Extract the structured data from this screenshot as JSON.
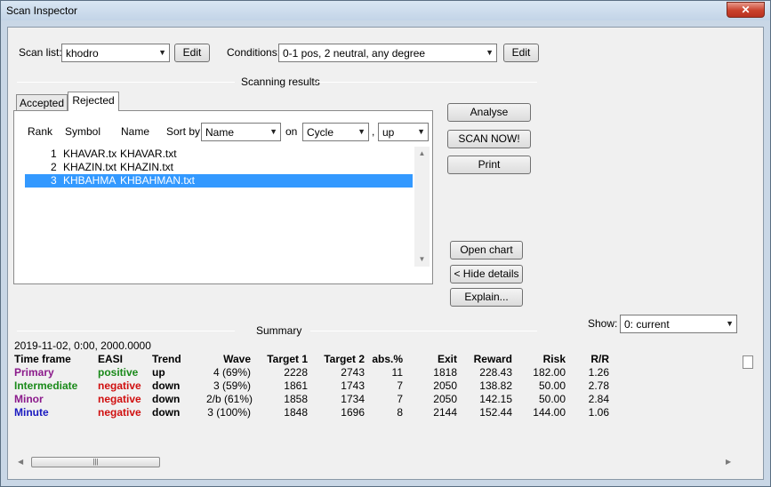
{
  "window": {
    "title": "Scan Inspector",
    "close_glyph": "✕"
  },
  "top": {
    "scan_list_label": "Scan list:",
    "scan_list_value": "khodro",
    "edit1_label": "Edit",
    "conditions_label": "Conditions:",
    "conditions_value": "0-1 pos, 2 neutral, any degree",
    "edit2_label": "Edit"
  },
  "results": {
    "section_label": "Scanning results",
    "tabs": [
      {
        "label": "Accepted"
      },
      {
        "label": "Rejected"
      }
    ],
    "headers": {
      "rank": "Rank",
      "symbol": "Symbol",
      "name": "Name",
      "sort_by": "Sort by",
      "on": "on",
      "comma": ","
    },
    "sort_by_value": "Name",
    "on_value": "Cycle",
    "direction_value": "up",
    "rows": [
      {
        "rank": "1",
        "symbol": "KHAVAR.tx",
        "name": "KHAVAR.txt"
      },
      {
        "rank": "2",
        "symbol": "KHAZIN.txt",
        "name": "KHAZIN.txt"
      },
      {
        "rank": "3",
        "symbol": "KHBAHMA",
        "name": "KHBAHMAN.txt"
      }
    ],
    "selected_index": 2
  },
  "side_buttons": {
    "analyse": "Analyse",
    "scan_now": "SCAN NOW!",
    "print": "Print",
    "open_chart": "Open chart",
    "hide_details": "< Hide details",
    "explain": "Explain..."
  },
  "summary": {
    "section_label": "Summary",
    "show_label": "Show:",
    "show_value": "0: current",
    "info_line": "2019-11-02, 0:00, 2000.0000",
    "headers": [
      "Time frame",
      "EASI",
      "Trend",
      "Wave",
      "Target 1",
      "Target 2",
      "abs.%",
      "Exit",
      "Reward",
      "Risk",
      "R/R"
    ],
    "rows": [
      {
        "tf": "Primary",
        "tf_color": "#8b1a8b",
        "easi": "positive",
        "easi_color": "#1a8a1a",
        "trend": "up",
        "wave": "4 (69%)",
        "t1": "2228",
        "t2": "2743",
        "abs": "11",
        "exit": "1818",
        "reward": "228.43",
        "risk": "182.00",
        "rr": "1.26"
      },
      {
        "tf": "Intermediate",
        "tf_color": "#1a8a1a",
        "easi": "negative",
        "easi_color": "#d01010",
        "trend": "down",
        "wave": "3 (59%)",
        "t1": "1861",
        "t2": "1743",
        "abs": "7",
        "exit": "2050",
        "reward": "138.82",
        "risk": "50.00",
        "rr": "2.78"
      },
      {
        "tf": "Minor",
        "tf_color": "#8b1a8b",
        "easi": "negative",
        "easi_color": "#d01010",
        "trend": "down",
        "wave": "2/b (61%)",
        "t1": "1858",
        "t2": "1734",
        "abs": "7",
        "exit": "2050",
        "reward": "142.15",
        "risk": "50.00",
        "rr": "2.84"
      },
      {
        "tf": "Minute",
        "tf_color": "#1a1ac0",
        "easi": "negative",
        "easi_color": "#d01010",
        "trend": "down",
        "wave": "3 (100%)",
        "t1": "1848",
        "t2": "1696",
        "abs": "8",
        "exit": "2144",
        "reward": "152.44",
        "risk": "144.00",
        "rr": "1.06"
      }
    ],
    "hscroll_grip": "|||"
  },
  "icons": {
    "dropdown": "▼",
    "scroll_up": "▲",
    "scroll_down": "▼",
    "scroll_left": "◀",
    "scroll_right": "▶"
  }
}
